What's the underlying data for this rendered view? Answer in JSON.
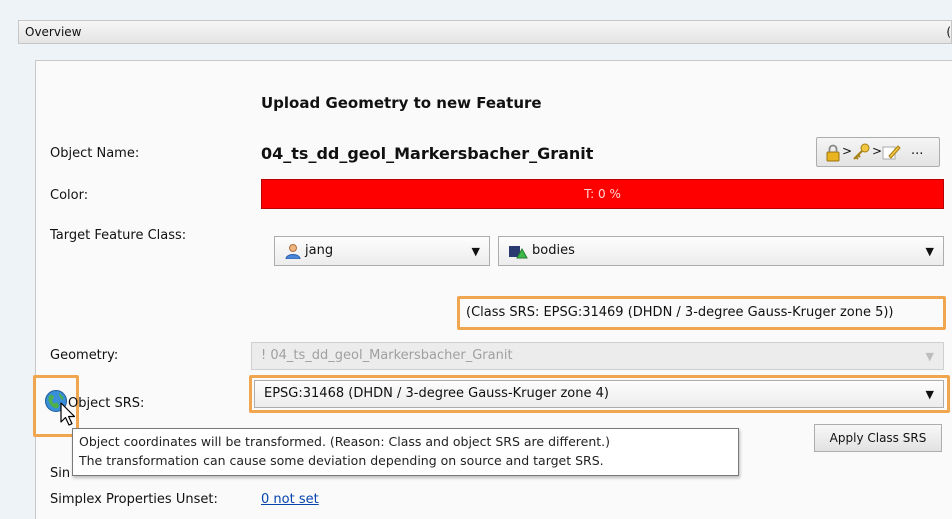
{
  "overview": {
    "title": "Overview",
    "edge_char": "("
  },
  "form": {
    "heading": "Upload Geometry to new Feature",
    "object_name_label": "Object Name:",
    "object_name_value": "04_ts_dd_geol_Markersbacher_Granit",
    "lock_button": {
      "icons": [
        "lock-icon",
        "key-icon",
        "pencil-icon"
      ],
      "sep": ">",
      "ellipsis": "..."
    },
    "color_label": "Color:",
    "color_value": "T: 0 %",
    "color_hex": "#ff0000",
    "target_class_label": "Target Feature Class:",
    "user_combo": {
      "value": "jang",
      "icon": "user-icon"
    },
    "class_combo": {
      "value": "bodies",
      "icon": "bodies-icon"
    },
    "class_srs_note": "(Class SRS: EPSG:31469 (DHDN / 3-degree Gauss-Kruger zone 5))",
    "geometry_label": "Geometry:",
    "geometry_value": "! 04_ts_dd_geol_Markersbacher_Granit",
    "object_srs_label": "Object SRS:",
    "object_srs_value": "EPSG:31468 (DHDN / 3-degree Gauss-Kruger zone 4)",
    "apply_button": "Apply Class SRS",
    "simplex_label_partial": "Sin",
    "simplex_unset_label": "Simplex Properties Unset:",
    "simplex_unset_value": "0 not set"
  },
  "tooltip": {
    "line1": "Object coordinates will be transformed. (Reason: Class and object SRS are different.)",
    "line2": "The transformation can cause some deviation depending on source and target SRS."
  },
  "colors": {
    "highlight": "#f0a64f",
    "link": "#0645ad"
  }
}
